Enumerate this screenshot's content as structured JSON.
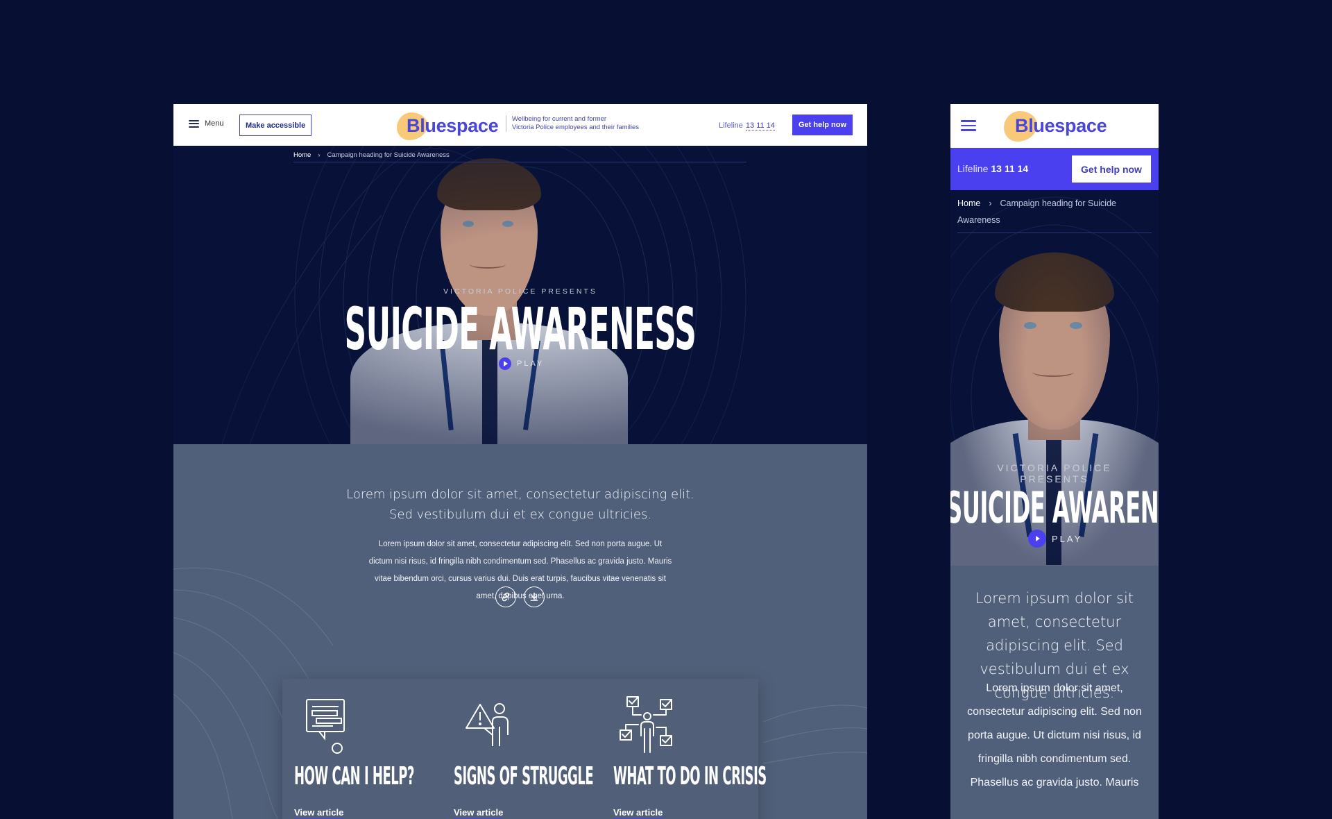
{
  "desktop": {
    "header": {
      "menu_label": "Menu",
      "make_accessible_label": "Make accessible",
      "logo_text": "Bluespace",
      "tagline_line1": "Wellbeing for current and former",
      "tagline_line2": "Victoria Police employees and their families",
      "lifeline_label": "Lifeline",
      "lifeline_number": "13 11 14",
      "get_help_label": "Get help now"
    },
    "breadcrumb": {
      "home": "Home",
      "separator": "›",
      "current": "Campaign heading for Suicide Awareness"
    },
    "hero": {
      "eyebrow": "VICTORIA POLICE PRESENTS",
      "title": "SUICIDE AWARENESS",
      "play_label": "PLAY"
    },
    "intro": {
      "lead": "Lorem ipsum dolor sit amet, consectetur adipiscing elit. Sed vestibulum dui et ex congue ultricies.",
      "body": "Lorem ipsum dolor sit amet, consectetur adipiscing elit. Sed non porta augue. Ut dictum nisi risus, id fringilla nibh condimentum sed. Phasellus ac gravida justo. Mauris vitae bibendum orci, cursus varius dui. Duis erat turpis, faucibus vitae venenatis sit amet, dapibus eget urna."
    },
    "actions": [
      {
        "icon": "link-icon"
      },
      {
        "icon": "download-icon"
      }
    ],
    "cards": [
      {
        "icon": "chat-list-icon",
        "title": "HOW CAN I HELP?",
        "link": "View article"
      },
      {
        "icon": "warning-person-icon",
        "title": "SIGNS OF STRUGGLE",
        "link": "View article"
      },
      {
        "icon": "checklist-person-icon",
        "title": "WHAT TO DO IN CRISIS",
        "link": "View article"
      }
    ]
  },
  "mobile": {
    "header": {
      "logo_text": "Bluespace",
      "lifeline_label": "Lifeline",
      "lifeline_number": "13 11 14",
      "get_help_label": "Get help now"
    },
    "breadcrumb": {
      "home": "Home",
      "separator": "›",
      "current": "Campaign heading for Suicide Awareness"
    },
    "hero": {
      "eyebrow": "VICTORIA POLICE PRESENTS",
      "title": "SUICIDE AWARENESS",
      "play_label": "PLAY"
    },
    "intro": {
      "lead": "Lorem ipsum dolor sit amet, consectetur adipiscing elit. Sed vestibulum dui et ex congue ultricies.",
      "body": "Lorem ipsum dolor sit amet, consectetur adipiscing elit. Sed non porta augue. Ut dictum nisi risus, id fringilla nibh condimentum sed. Phasellus ac gravida justo. Mauris"
    }
  },
  "colors": {
    "page_bg": "#070f33",
    "brand_blue": "#4b40f0",
    "logo_blob": "#f9c97a",
    "body_slate": "#51607a"
  }
}
